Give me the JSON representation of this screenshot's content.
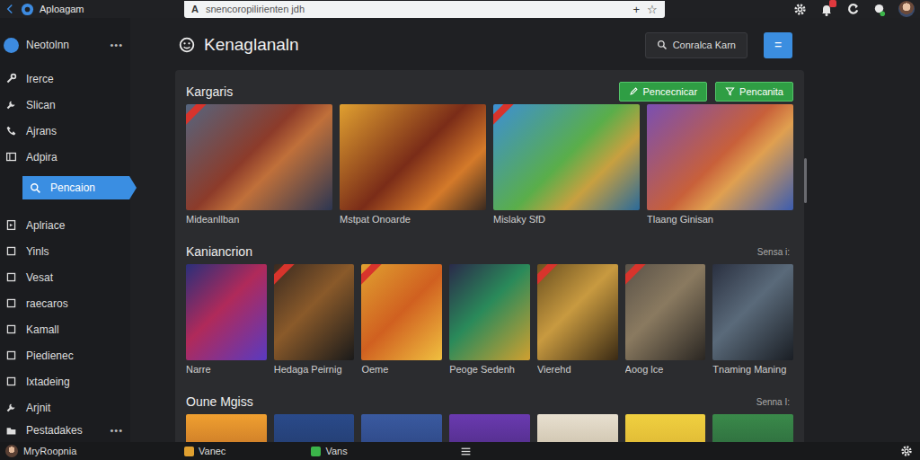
{
  "browser": {
    "app_title": "Aploagam",
    "address_prefix": "A",
    "address": "snencoropilirienten jdh",
    "new_tab": "+",
    "bookmark": "☆",
    "notification_badge": true
  },
  "sidebar": {
    "header": "Neotolnn",
    "header_more": "•••",
    "items": [
      {
        "label": "Irerce",
        "selected": false
      },
      {
        "label": "Slican",
        "selected": false
      },
      {
        "label": "Ajrans",
        "selected": false
      },
      {
        "label": "Adpira",
        "selected": false
      },
      {
        "label": "Pencaion",
        "selected": true
      },
      {
        "label": "Aplriace",
        "selected": false
      },
      {
        "label": "Yinls",
        "selected": false
      },
      {
        "label": "Vesat",
        "selected": false
      },
      {
        "label": "raecaros",
        "selected": false
      },
      {
        "label": "Kamall",
        "selected": false
      },
      {
        "label": "Piedienec",
        "selected": false
      },
      {
        "label": "Ixtadeing",
        "selected": false
      },
      {
        "label": "Arjnit",
        "selected": false
      }
    ],
    "footer": {
      "label": "Pestadakes",
      "more": "•••"
    }
  },
  "main": {
    "title": "Kenaglanaln",
    "search_button": "Conralca Karn",
    "menu_button": "="
  },
  "panel": {
    "scroll_level": 0.2
  },
  "sections": [
    {
      "title": "Kargaris",
      "kind": "large",
      "actions": [
        "Pencecnicar",
        "Pencanita"
      ],
      "cards": [
        {
          "label": "Mideanllban",
          "ribbon": true
        },
        {
          "label": "Mstpat Onoarde",
          "ribbon": false
        },
        {
          "label": "Mislaky SfD",
          "ribbon": true
        },
        {
          "label": "Tlaang Ginisan",
          "ribbon": false
        }
      ]
    },
    {
      "title": "Kaniancrion",
      "kind": "small",
      "side": "Sensa i:",
      "cards": [
        {
          "label": "Narre",
          "ribbon": false
        },
        {
          "label": "Hedaga Peirnig",
          "ribbon": true
        },
        {
          "label": "Oeme",
          "ribbon": true
        },
        {
          "label": "Peoge Sedenh",
          "ribbon": false
        },
        {
          "label": "Vierehd",
          "ribbon": true
        },
        {
          "label": "Aoog lce",
          "ribbon": true
        },
        {
          "label": "Tnaming Maning",
          "ribbon": false
        }
      ]
    },
    {
      "title": "Oune Mgiss",
      "kind": "small",
      "side": "Senna I:",
      "cards": [
        {
          "ribbon": false
        },
        {
          "ribbon": false
        },
        {
          "ribbon": false
        },
        {
          "ribbon": false
        },
        {
          "ribbon": false
        },
        {
          "ribbon": false
        },
        {
          "ribbon": false
        }
      ]
    }
  ],
  "taskbar": {
    "user": "MryRoopnia",
    "apps": [
      {
        "label": "Vanec"
      },
      {
        "label": "Vans"
      }
    ]
  }
}
